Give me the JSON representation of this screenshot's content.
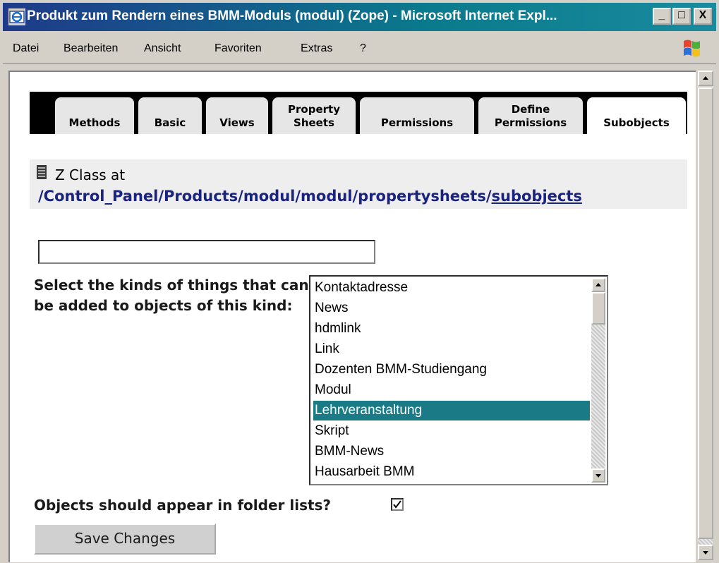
{
  "window": {
    "title": "Produkt zum Rendern eines BMM-Moduls (modul) (Zope) - Microsoft Internet Expl...",
    "buttons": {
      "minimize": "_",
      "maximize": "□",
      "close": "X"
    }
  },
  "menubar": {
    "items": [
      {
        "label": "Datei"
      },
      {
        "label": "Bearbeiten"
      },
      {
        "label": "Ansicht"
      },
      {
        "label": "Favoriten"
      },
      {
        "label": "Extras"
      },
      {
        "label": "?"
      }
    ]
  },
  "tabs": [
    {
      "label": "Methods"
    },
    {
      "label": "Basic"
    },
    {
      "label": "Views"
    },
    {
      "label": "Property Sheets"
    },
    {
      "label": "Permissions"
    },
    {
      "label": "Define Permissions"
    },
    {
      "label": "Subobjects"
    }
  ],
  "header": {
    "class_label": "Z Class at",
    "path_prefix": "/Control_Panel/Products/modul/modul/propertysheets/",
    "path_link": "subobjects"
  },
  "form": {
    "text_input_value": "",
    "select_label": "Select the kinds of things that can be added to objects of this kind:",
    "list_items": [
      "Kontaktadresse",
      "News",
      "hdmlink",
      "Link",
      "Dozenten BMM-Studiengang",
      "Modul",
      "Lehrveranstaltung",
      "Skript",
      "BMM-News",
      "Hausarbeit BMM"
    ],
    "selected_item": "Lehrveranstaltung",
    "folder_label": "Objects should appear in folder lists?",
    "folder_checked": true,
    "save_label": "Save Changes"
  },
  "colors": {
    "tab_bar": "#000000",
    "selection": "#1a7a86",
    "path_text": "#1a237e"
  }
}
